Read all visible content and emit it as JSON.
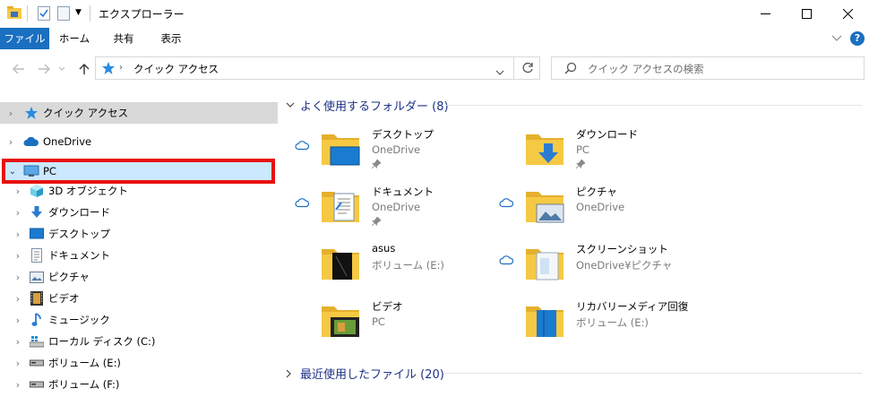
{
  "window": {
    "title": "エクスプローラー",
    "minimize_label": "—",
    "maximize_label": "☐",
    "close_label": "✕"
  },
  "ribbon": {
    "tabs": [
      "ファイル",
      "ホーム",
      "共有",
      "表示"
    ],
    "help_label": "?"
  },
  "address": {
    "path": "クイック アクセス",
    "search_placeholder": "クイック アクセスの検索"
  },
  "navpane": {
    "items": [
      {
        "label": "クイック アクセス",
        "icon": "star-icon"
      },
      {
        "label": "OneDrive",
        "icon": "cloud-icon"
      },
      {
        "label": "PC",
        "icon": "computer-icon"
      },
      {
        "label": "3D オブジェクト",
        "icon": "cube-icon"
      },
      {
        "label": "ダウンロード",
        "icon": "download-icon"
      },
      {
        "label": "デスクトップ",
        "icon": "desktop-icon"
      },
      {
        "label": "ドキュメント",
        "icon": "document-icon"
      },
      {
        "label": "ピクチャ",
        "icon": "picture-icon"
      },
      {
        "label": "ビデオ",
        "icon": "video-icon"
      },
      {
        "label": "ミュージック",
        "icon": "music-icon"
      },
      {
        "label": "ローカル ディスク (C:)",
        "icon": "windows-drive-icon"
      },
      {
        "label": "ボリューム (E:)",
        "icon": "drive-icon"
      },
      {
        "label": "ボリューム (F:)",
        "icon": "drive-icon"
      }
    ]
  },
  "content": {
    "frequent_header": "よく使用するフォルダー (8)",
    "recent_header": "最近使用したファイル (20)",
    "folders": [
      {
        "name": "デスクトップ",
        "location": "OneDrive",
        "pinned": true,
        "cloud": true,
        "icon": "desktop-folder-icon"
      },
      {
        "name": "ダウンロード",
        "location": "PC",
        "pinned": true,
        "cloud": false,
        "icon": "download-folder-icon"
      },
      {
        "name": "ドキュメント",
        "location": "OneDrive",
        "pinned": true,
        "cloud": true,
        "icon": "document-folder-icon"
      },
      {
        "name": "ピクチャ",
        "location": "OneDrive",
        "pinned": false,
        "cloud": true,
        "icon": "picture-folder-icon"
      },
      {
        "name": "asus",
        "location": "ボリューム (E:)",
        "pinned": false,
        "cloud": false,
        "icon": "asus-folder-icon"
      },
      {
        "name": "スクリーンショット",
        "location": "OneDrive¥ピクチャ",
        "pinned": false,
        "cloud": true,
        "icon": "screenshot-folder-icon"
      },
      {
        "name": "ビデオ",
        "location": "PC",
        "pinned": false,
        "cloud": false,
        "icon": "video-folder-icon"
      },
      {
        "name": "リカバリーメディア回復",
        "location": "ボリューム (E:)",
        "pinned": false,
        "cloud": false,
        "icon": "recovery-folder-icon"
      }
    ]
  },
  "colors": {
    "accent": "#1a6fc0",
    "selection": "#cce8ff",
    "highlight_box": "#e81010",
    "quick_access_bg": "#d9d9d9",
    "folder_yellow": "#f5c944",
    "group_header": "#1e3287"
  }
}
